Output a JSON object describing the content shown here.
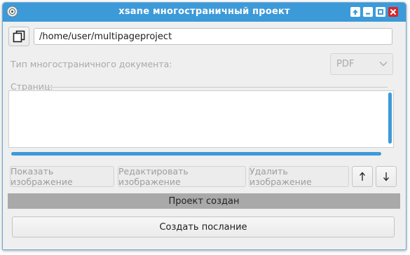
{
  "window": {
    "title": "xsane многостраничный проект",
    "accent_color": "#3d9ad9",
    "controls": [
      "maximize-icon",
      "minimize-icon",
      "restore-icon",
      "close-icon"
    ]
  },
  "project": {
    "path_value": "/home/user/multipageproject",
    "choose_dir_icon": "copy-pages-icon"
  },
  "doc_type": {
    "label": "Тип многостраничного документа:",
    "selected": "PDF"
  },
  "pages": {
    "legend": "Страниц:",
    "items": []
  },
  "buttons": {
    "show_image": "Показать изображение",
    "edit_image": "Редактировать изображение",
    "delete_image": "Удалить изображение",
    "move_up_icon": "arrow-up-icon",
    "move_down_icon": "arrow-down-icon",
    "create_message": "Создать послание"
  },
  "status": {
    "text": "Проект создан"
  }
}
